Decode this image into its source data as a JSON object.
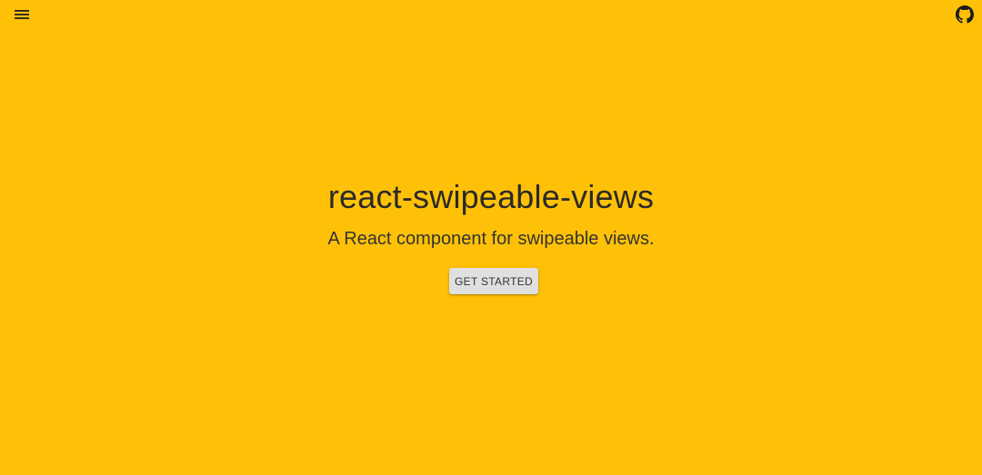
{
  "header": {
    "menu_icon": "hamburger-menu-icon",
    "github_icon": "github-icon"
  },
  "hero": {
    "title": "react-swipeable-views",
    "subtitle": "A React component for swipeable views.",
    "cta_label": "GET STARTED"
  },
  "colors": {
    "background": "#FFC107",
    "button": "#E0E0E0",
    "text": "#2B2B2B"
  }
}
